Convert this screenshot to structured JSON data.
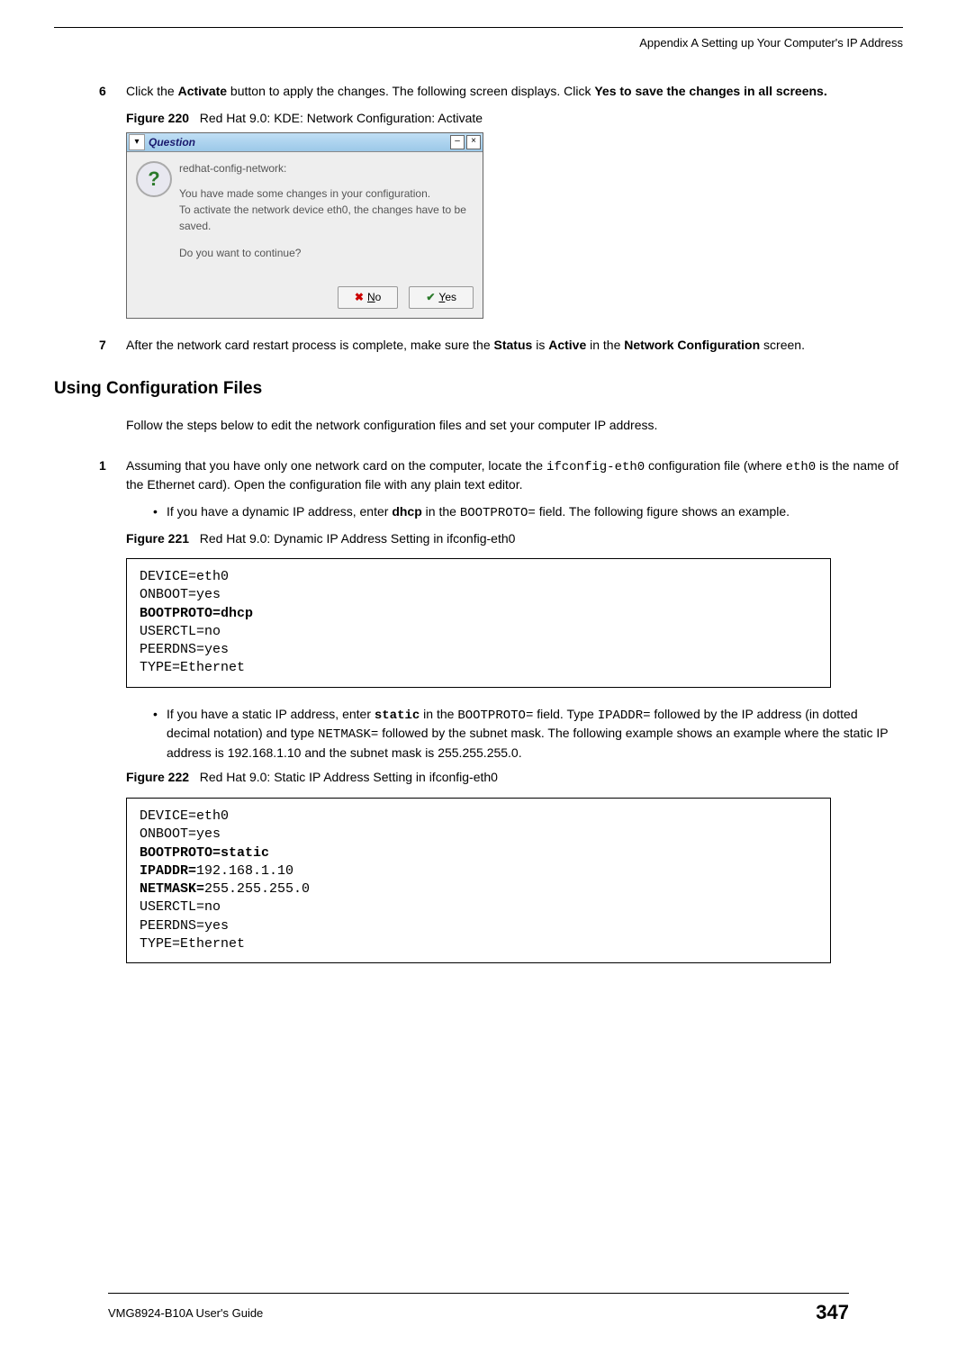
{
  "header": {
    "appendix": "Appendix A Setting up Your Computer's IP Address"
  },
  "step6": {
    "num": "6",
    "pre": "Click the ",
    "b1": "Activate",
    "mid": " button to apply the changes. The following screen displays. Click ",
    "b2": "Yes to save the changes in all screens."
  },
  "fig220": {
    "label": "Figure 220",
    "caption": "Red Hat 9.0: KDE: Network Configuration: Activate"
  },
  "dialog": {
    "title": "Question",
    "smallTitle": "redhat-config-network:",
    "msg1": "You have made some changes in your configuration.",
    "msg2": "To activate the network device eth0, the changes have to be saved.",
    "msg3": "Do you want to continue?",
    "noBtn": "No",
    "yesBtn": "Yes"
  },
  "step7": {
    "num": "7",
    "pre": "After the network card restart process is complete, make sure the ",
    "b1": "Status",
    "mid": " is ",
    "b2": "Active",
    "mid2": " in the ",
    "b3": "Network Configuration",
    "end": " screen."
  },
  "sectionHeading": "Using Configuration Files",
  "intro": "Follow the steps below to edit the network configuration files and set your computer IP address.",
  "step1b": {
    "num": "1",
    "pre": "Assuming that you have only one network card on the computer, locate the ",
    "code1": "ifconfig-eth0",
    "mid": " configuration file (where ",
    "code2": "eth0",
    "end": " is the name of the Ethernet card). Open the configuration file with any plain text editor."
  },
  "bullet1": {
    "pre": "If you have a dynamic IP address, enter ",
    "b1": "dhcp",
    "mid": " in the ",
    "code1": "BOOTPROTO=",
    "end": " field.  The following figure shows an example."
  },
  "fig221": {
    "label": "Figure 221",
    "caption": "Red Hat 9.0: Dynamic IP Address Setting in ifconfig-eth0"
  },
  "code1": {
    "l1": "DEVICE=eth0",
    "l2": "ONBOOT=yes",
    "l3b": "BOOTPROTO=dhcp",
    "l4": "USERCTL=no",
    "l5": "PEERDNS=yes",
    "l6": "TYPE=Ethernet"
  },
  "bullet2": {
    "pre": "If you have a static IP address, enter ",
    "b1": "static",
    "mid": " in the ",
    "code1": "BOOTPROTO=",
    "mid2": " field. Type ",
    "code2": "IPADDR=",
    "mid3": " followed by the IP address (in dotted decimal notation) and type ",
    "code3": "NETMASK=",
    "end": " followed by the subnet mask. The following example shows an example where the static IP address is 192.168.1.10 and the subnet mask is 255.255.255.0."
  },
  "fig222": {
    "label": "Figure 222",
    "caption": "Red Hat 9.0: Static IP Address Setting in ifconfig-eth0"
  },
  "code2": {
    "l1": "DEVICE=eth0",
    "l2": "ONBOOT=yes",
    "l3b": "BOOTPROTO=static",
    "l4b_pre": "IPADDR=",
    "l4b_val": "192.168.1.10",
    "l5b_pre": "NETMASK=",
    "l5b_val": "255.255.255.0",
    "l6": "USERCTL=no",
    "l7": "PEERDNS=yes",
    "l8": "TYPE=Ethernet"
  },
  "footer": {
    "left": "VMG8924-B10A User's Guide",
    "right": "347"
  }
}
